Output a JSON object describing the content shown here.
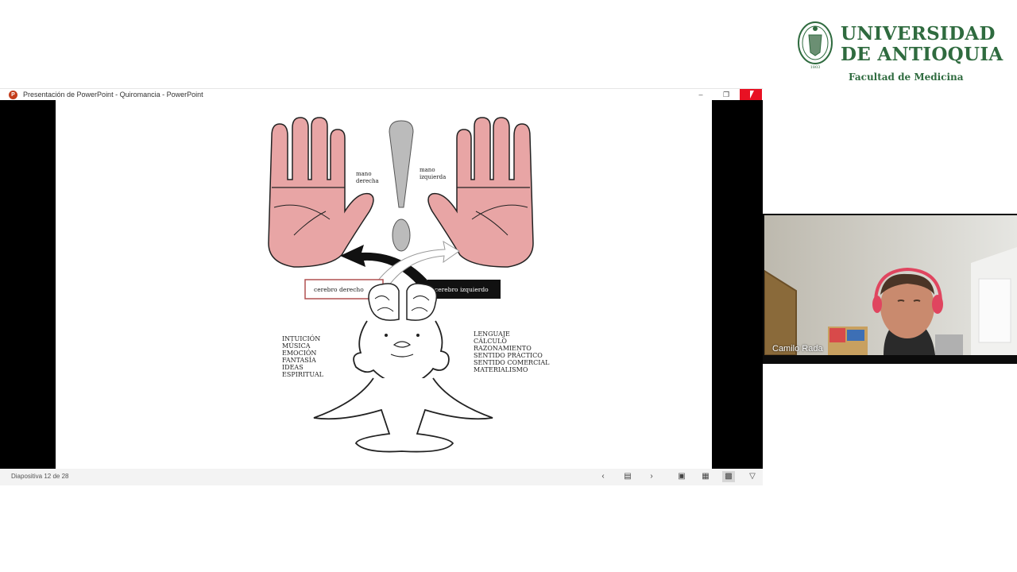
{
  "university": {
    "name_line1": "UNIVERSIDAD",
    "name_line2": "DE ANTIOQUIA",
    "faculty": "Facultad de Medicina",
    "seal_year": "1803"
  },
  "window": {
    "title": "Presentación de PowerPoint  -  Quiromancia  -  PowerPoint",
    "minimize_icon": "minimize-icon",
    "restore_icon": "restore-icon",
    "close_icon": "close-icon"
  },
  "slide": {
    "label_right_hand": [
      "mano",
      "derecha"
    ],
    "label_left_hand": [
      "mano",
      "izquierda"
    ],
    "right_brain": "cerebro derecho",
    "left_brain": "cerebro izquierdo",
    "right_brain_traits": [
      "INTUICIÓN",
      "MÚSICA",
      "EMOCIÓN",
      "FANTASÍA",
      "IDEAS",
      "ESPIRITUAL"
    ],
    "left_brain_traits": [
      "LENGUAJE",
      "CÁLCULO",
      "RAZONAMIENTO",
      "SENTIDO PRÁCTICO",
      "SENTIDO COMERCIAL",
      "MATERIALISMO"
    ]
  },
  "statusbar": {
    "slide_counter": "Diapositiva 12 de 28",
    "icons": [
      "prev-slide-icon",
      "slide-menu-icon",
      "next-slide-icon",
      "normal-view-icon",
      "slide-sorter-icon",
      "reading-view-icon",
      "presenter-view-icon"
    ]
  },
  "video": {
    "participant_name": "Camilo Rada"
  },
  "colors": {
    "brand_green": "#2f6b3f",
    "close_red": "#e81123",
    "palm_pink": "#e8a5a5"
  }
}
